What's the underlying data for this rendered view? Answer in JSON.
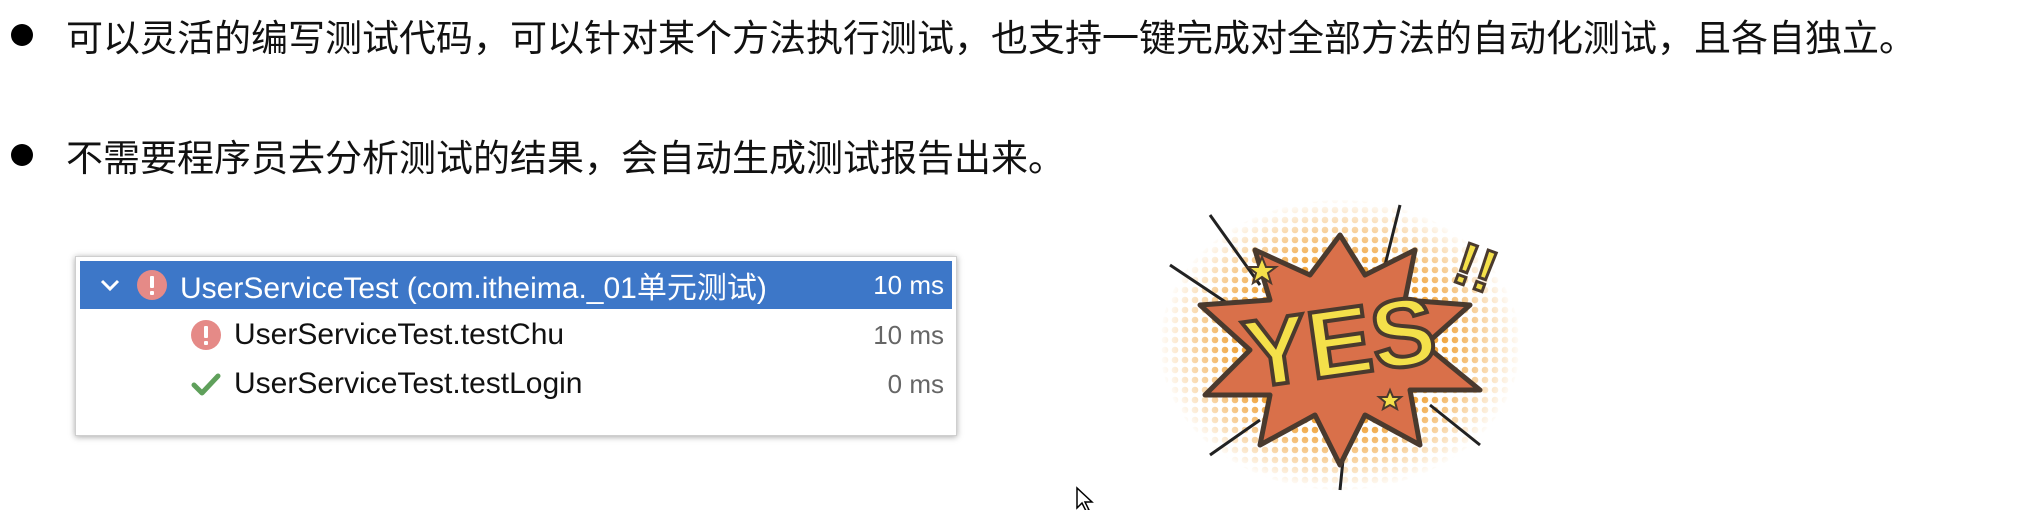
{
  "bullets": [
    "可以灵活的编写测试代码，可以针对某个方法执行测试，也支持一键完成对全部方法的自动化测试，且各自独立。",
    "不需要程序员去分析测试的结果，会自动生成测试报告出来。"
  ],
  "test_runner": {
    "rows": [
      {
        "label": "UserServiceTest (com.itheima._01单元测试)",
        "time": "10 ms",
        "status": "error",
        "selected": true,
        "expanded": true
      },
      {
        "label": "UserServiceTest.testChu",
        "time": "10 ms",
        "status": "error"
      },
      {
        "label": "UserServiceTest.testLogin",
        "time": "0 ms",
        "status": "passed"
      }
    ]
  },
  "illustration": {
    "text": "YES"
  },
  "colors": {
    "selection": "#3d77c8",
    "error": "#e58a87",
    "success": "#5fa05b",
    "burst": "#d9704a",
    "burst_outline": "#4a3a2e",
    "halftone": "#f0a33a",
    "yes_text": "#f4e04a"
  }
}
